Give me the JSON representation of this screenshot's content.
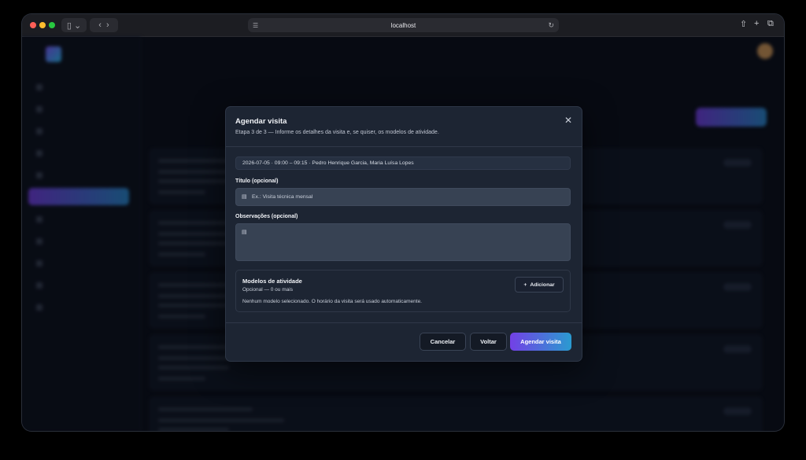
{
  "browser": {
    "url": "localhost",
    "colors": {
      "close": "#ff5f57",
      "minimize": "#febc2e",
      "zoom": "#28c840"
    }
  },
  "modal": {
    "title": "Agendar visita",
    "subtitle": "Etapa 3 de 3 — Informe os detalhes da visita e, se quiser, os modelos de atividade.",
    "summary": "2026-07-05 · 09:00 – 09:15 · Pedro Henrique Garcia, Maria Luísa Lopes",
    "title_field": {
      "label": "Título (opcional)",
      "placeholder": "Ex.: Visita técnica mensal",
      "value": ""
    },
    "notes_field": {
      "label": "Observações (opcional)",
      "value": ""
    },
    "models": {
      "title": "Modelos de atividade",
      "subtitle": "Opcional — 0 ou mais",
      "empty_text": "Nenhum modelo selecionado. O horário da visita será usado automaticamente.",
      "add_label": "Adicionar"
    },
    "buttons": {
      "cancel": "Cancelar",
      "back": "Voltar",
      "submit": "Agendar visita"
    },
    "colors": {
      "primary_start": "#7340e6",
      "primary_end": "#2a9bd0",
      "surface": "#1d2533",
      "field": "#374253"
    }
  }
}
